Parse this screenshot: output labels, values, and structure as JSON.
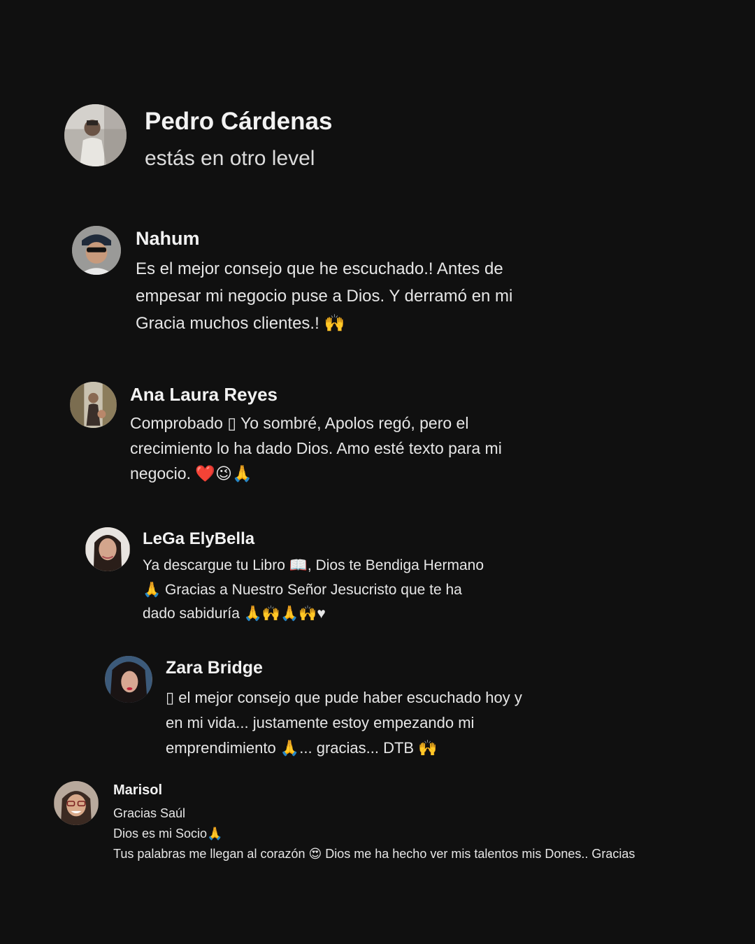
{
  "comments": [
    {
      "name": "Pedro Cárdenas",
      "lines": [
        "estás en otro level"
      ]
    },
    {
      "name": "Nahum",
      "lines": [
        "Es el mejor consejo que he escuchado.! Antes de",
        "empesar mi negocio puse a Dios. Y derramó en mi",
        "Gracia muchos clientes.! 🙌"
      ]
    },
    {
      "name": "Ana Laura Reyes",
      "lines": [
        "Comprobado ▯ Yo sombré, Apolos regó, pero el",
        "crecimiento lo ha dado Dios. Amo esté texto para mi",
        "negocio. ❤️😉🙏"
      ]
    },
    {
      "name": "LeGa ElyBella",
      "lines": [
        "Ya descargue tu Libro 📖, Dios te Bendiga Hermano",
        "🙏 Gracias a Nuestro Señor Jesucristo que te ha",
        "dado sabiduría 🙏🙌🙏🙌♥"
      ]
    },
    {
      "name": "Zara Bridge",
      "lines": [
        "▯ el mejor consejo que pude haber escuchado hoy y",
        "en mi vida... justamente estoy empezando mi",
        "emprendimiento 🙏... gracias... DTB 🙌"
      ]
    },
    {
      "name": "Marisol",
      "lines": [
        "Gracias Saúl",
        "Dios es mi Socio🙏",
        "Tus palabras me llegan al corazón 😍 Dios me ha hecho ver mis talentos mis Dones.. Gracias"
      ]
    }
  ]
}
